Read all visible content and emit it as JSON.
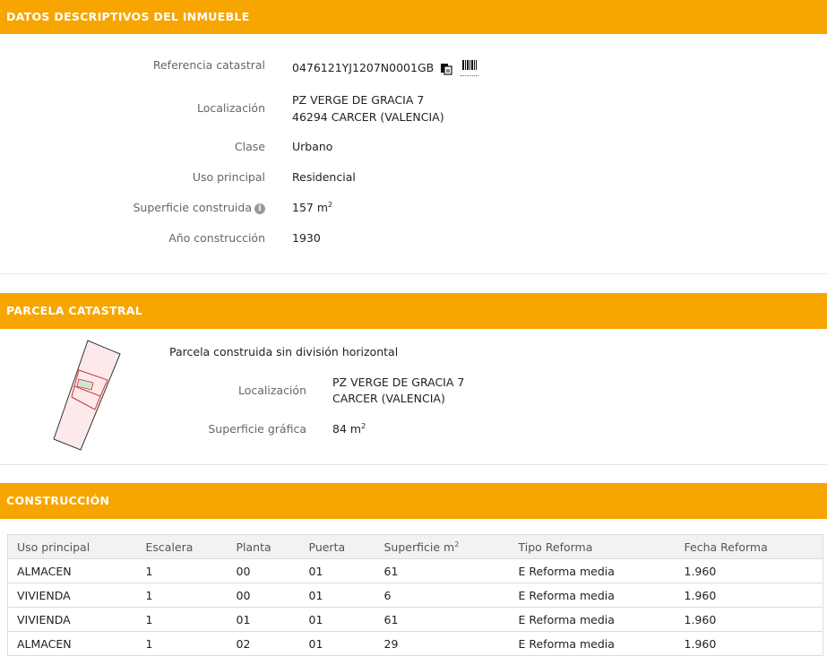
{
  "sections": {
    "datos": {
      "title": "DATOS DESCRIPTIVOS DEL INMUEBLE"
    },
    "parcela": {
      "title": "PARCELA CATASTRAL"
    },
    "construccion": {
      "title": "CONSTRUCCIÓN"
    }
  },
  "inmueble": {
    "referencia_label": "Referencia catastral",
    "referencia_value": "0476121YJ1207N0001GB",
    "localizacion_label": "Localización",
    "localizacion_line1": "PZ VERGE DE GRACIA 7",
    "localizacion_line2": "46294 CARCER (VALENCIA)",
    "clase_label": "Clase",
    "clase_value": "Urbano",
    "uso_label": "Uso principal",
    "uso_value": "Residencial",
    "superficie_label": "Superficie construida",
    "superficie_value": "157 m",
    "superficie_exp": "2",
    "anio_label": "Año construcción",
    "anio_value": "1930"
  },
  "parcela": {
    "descripcion": "Parcela construida sin división horizontal",
    "localizacion_label": "Localización",
    "localizacion_line1": "PZ VERGE DE GRACIA 7",
    "localizacion_line2": "CARCER (VALENCIA)",
    "superficie_label": "Superficie gráfica",
    "superficie_value": "84 m",
    "superficie_exp": "2"
  },
  "construccion": {
    "headers": [
      "Uso principal",
      "Escalera",
      "Planta",
      "Puerta",
      "Superficie m",
      "Tipo Reforma",
      "Fecha Reforma"
    ],
    "superficie_exp": "2",
    "rows": [
      [
        "ALMACEN",
        "1",
        "00",
        "01",
        "61",
        "E Reforma media",
        "1.960"
      ],
      [
        "VIVIENDA",
        "1",
        "00",
        "01",
        "6",
        "E Reforma media",
        "1.960"
      ],
      [
        "VIVIENDA",
        "1",
        "01",
        "01",
        "61",
        "E Reforma media",
        "1.960"
      ],
      [
        "ALMACEN",
        "1",
        "02",
        "01",
        "29",
        "E Reforma media",
        "1.960"
      ]
    ]
  },
  "colors": {
    "header_bg": "#f7a500",
    "parcel_fill": "#fde9ea",
    "parcel_stroke": "#cc3333"
  },
  "icons": {
    "copy": "copy-icon",
    "barcode": "barcode-icon",
    "info": "info-icon"
  }
}
